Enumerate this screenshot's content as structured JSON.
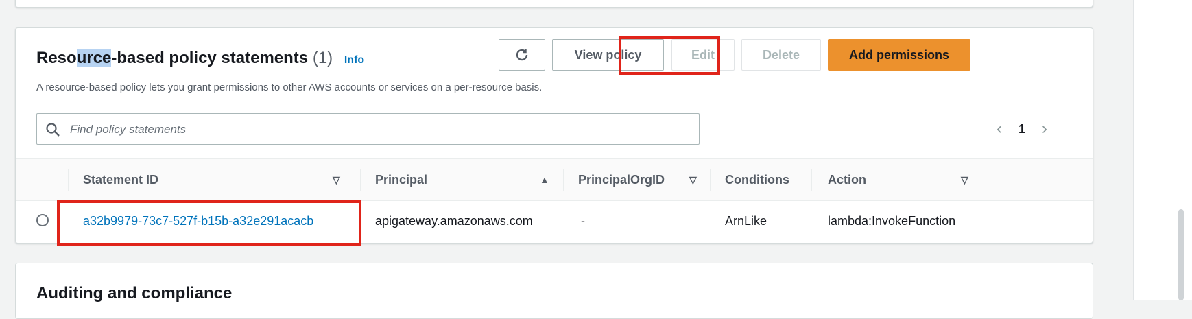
{
  "card": {
    "title_pre": "Reso",
    "title_hl": "urce",
    "title_post": "-based policy statements",
    "count": "(1)",
    "info": "Info",
    "description": "A resource-based policy lets you grant permissions to other AWS accounts or services on a per-resource basis."
  },
  "buttons": {
    "refresh_icon": "refresh-icon",
    "view_policy": "View policy",
    "edit": "Edit",
    "delete": "Delete",
    "add_permissions": "Add permissions"
  },
  "search": {
    "placeholder": "Find policy statements",
    "value": ""
  },
  "pagination": {
    "prev": "‹",
    "page": "1",
    "next": "›"
  },
  "table": {
    "columns": [
      {
        "label": "Statement ID",
        "sort": "▽"
      },
      {
        "label": "Principal",
        "sort": "▲"
      },
      {
        "label": "PrincipalOrgID",
        "sort": "▽"
      },
      {
        "label": "Conditions",
        "sort": ""
      },
      {
        "label": "Action",
        "sort": "▽"
      }
    ],
    "rows": [
      {
        "statement_id": "a32b9979-73c7-527f-b15b-a32e291acacb",
        "principal": "apigateway.amazonaws.com",
        "principal_org_id": "-",
        "conditions": "ArnLike",
        "action": "lambda:InvokeFunction"
      }
    ]
  },
  "next_section": {
    "title": "Auditing and compliance"
  },
  "colors": {
    "accent": "#ec912d",
    "link": "#0073bb",
    "highlight": "#e0241a"
  }
}
